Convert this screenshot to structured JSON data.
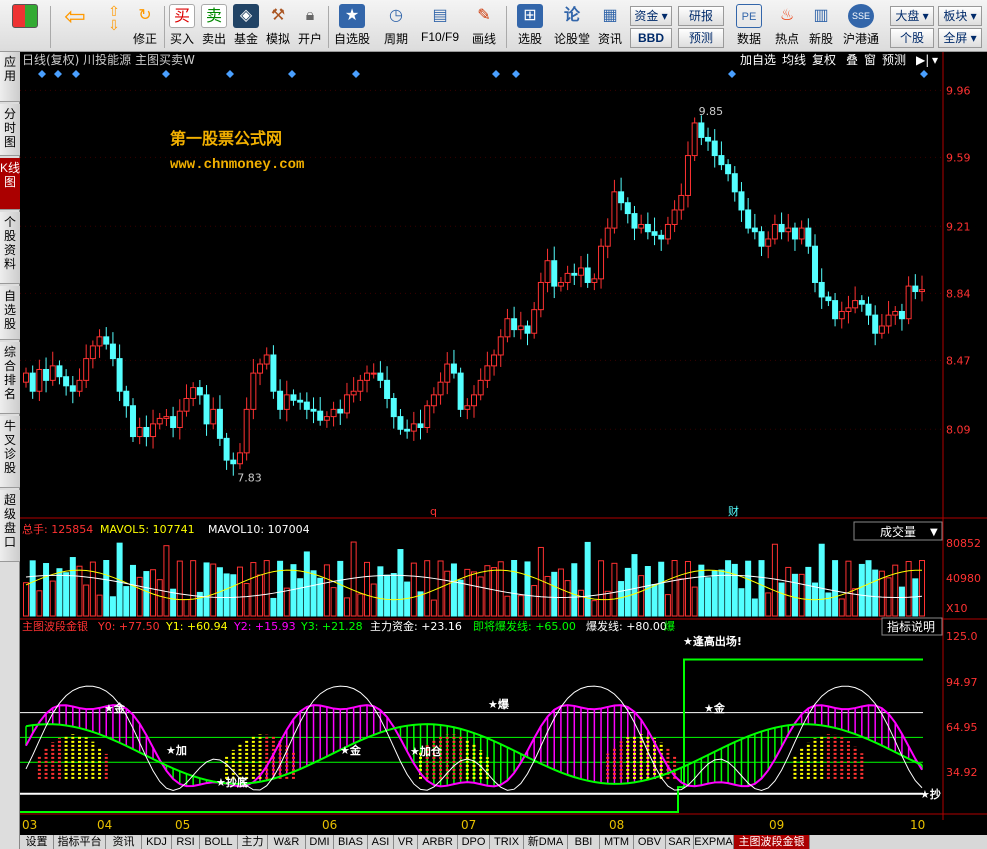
{
  "toolbar": {
    "buttons": [
      {
        "label": "",
        "icon": "app-logo-icon"
      },
      {
        "label": "",
        "icon": "back-arrow-icon"
      },
      {
        "label": "修正",
        "icon": "correct-icon"
      },
      {
        "label": "买入",
        "icon": "buy-icon"
      },
      {
        "label": "卖出",
        "icon": "sell-icon"
      },
      {
        "label": "基金",
        "icon": "fund-icon"
      },
      {
        "label": "模拟",
        "icon": "simulate-icon"
      },
      {
        "label": "开户",
        "icon": "lock-icon"
      },
      {
        "label": "自选股",
        "icon": "star-icon"
      },
      {
        "label": "周期",
        "icon": "clock-icon"
      },
      {
        "label": "F10/F9",
        "icon": "f10-icon"
      },
      {
        "label": "画线",
        "icon": "pen-icon"
      },
      {
        "label": "选股",
        "icon": "filter-icon"
      },
      {
        "label": "论股堂",
        "icon": "forum-icon"
      },
      {
        "label": "资讯",
        "icon": "news-icon"
      },
      {
        "label": "数据",
        "icon": "pe-icon"
      },
      {
        "label": "热点",
        "icon": "hot-icon"
      },
      {
        "label": "新股",
        "icon": "newstock-icon"
      },
      {
        "label": "沪港通",
        "icon": "hk-icon"
      }
    ],
    "buy_glyph": "买",
    "sell_glyph": "卖",
    "small": {
      "zijin": "资金",
      "bbd": "BBD",
      "yanbao": "研报",
      "yuce": "预测",
      "dapan": "大盘",
      "bankuai": "板块",
      "gegu": "个股",
      "quanping": "全屏"
    }
  },
  "sidenav": [
    "应用",
    "分时图",
    "K线图",
    "个股资料",
    "自选股",
    "综合排名",
    "牛叉诊股",
    "超级盘口"
  ],
  "kline": {
    "header": "日线(复权)  川投能源  主图买卖W",
    "buttons": [
      "加自选",
      "均线",
      "复权",
      "叠",
      "窗",
      "预测"
    ],
    "watermark_title": "第一股票公式网",
    "watermark_url": "www.chnmoney.com",
    "y_ticks": [
      "9.96",
      "9.59",
      "9.21",
      "8.84",
      "8.47",
      "8.09"
    ],
    "max_label": "9.85",
    "min_label": "7.83",
    "marker_q": "q",
    "marker_cai": "财"
  },
  "volume": {
    "total": "总手: 125854",
    "mavol5": "MAVOL5: 107741",
    "mavol10": "MAVOL10: 107004",
    "select": "成交量",
    "y_ticks": [
      "80852",
      "40980",
      "X10"
    ]
  },
  "indicator": {
    "name": "主图波段金银",
    "y0": "Y0: +77.50",
    "y1": "Y1: +60.94",
    "y2": "Y2: +15.93",
    "y3": "Y3: +21.28",
    "zhuli": "主力资金: +23.16",
    "jijiang": "即将爆发线: +65.00",
    "baofa": "爆发线: +80.00",
    "bao": "爆",
    "help": "指标说明",
    "y_ticks": [
      "125.0",
      "94.97",
      "64.95",
      "34.92"
    ],
    "annotations": {
      "escape": "★逢高出场!",
      "buy1": "★金",
      "chaodi": "★抄底",
      "jia1": "★加",
      "jia2": "★加仓",
      "jin2": "★金",
      "chao": "★抄",
      "baofa": "★爆",
      "jin3": "★金"
    }
  },
  "dates": [
    "03",
    "04",
    "05",
    "06",
    "07",
    "08",
    "09",
    "10"
  ],
  "tabs": [
    "设置",
    "指标平台",
    "资讯",
    "KDJ",
    "RSI",
    "BOLL",
    "主力",
    "W&R",
    "DMI",
    "BIAS",
    "ASI",
    "VR",
    "ARBR",
    "DPO",
    "TRIX",
    "新DMA",
    "BBI",
    "MTM",
    "OBV",
    "SAR",
    "EXPMA",
    "主图波段金银"
  ],
  "colors": {
    "up": "#ff3232",
    "down": "#54ffff",
    "axis": "#b00000",
    "ma": "#ffffff",
    "yellow": "#ffff00",
    "green": "#00ff00",
    "magenta": "#ff00ff"
  },
  "chart_data": [
    {
      "type": "candlestick",
      "title": "川投能源 日线(复权)",
      "x": [
        "03",
        "04",
        "05",
        "06",
        "07",
        "08",
        "09",
        "10"
      ],
      "ylim": [
        7.7,
        10.05
      ],
      "open": [
        8.35,
        8.4,
        8.3,
        8.42,
        8.36,
        8.44,
        8.38,
        8.33,
        8.3,
        8.36,
        8.48,
        8.55,
        8.6,
        8.56,
        8.48,
        8.3,
        8.22,
        8.05,
        8.1,
        8.05,
        8.12,
        8.15,
        8.16,
        8.1,
        8.19,
        8.26,
        8.32,
        8.28,
        8.12,
        8.2,
        8.04,
        7.92,
        7.9,
        7.96,
        8.2,
        8.4,
        8.45,
        8.5,
        8.3,
        8.2,
        8.28,
        8.25,
        8.24,
        8.2,
        8.19,
        8.14,
        8.16,
        8.2,
        8.18,
        8.28,
        8.3,
        8.36,
        8.4,
        8.4,
        8.36,
        8.26,
        8.16,
        8.09,
        8.08,
        8.12,
        8.1,
        8.22,
        8.28,
        8.35,
        8.45,
        8.4,
        8.2,
        8.22,
        8.28,
        8.36,
        8.44,
        8.5,
        8.6,
        8.7,
        8.64,
        8.66,
        8.62,
        8.75,
        8.9,
        9.02,
        8.88,
        8.9,
        8.95,
        8.94,
        8.98,
        8.9,
        8.92,
        9.1,
        9.2,
        9.4,
        9.34,
        9.28,
        9.2,
        9.22,
        9.18,
        9.16,
        9.14,
        9.22,
        9.3,
        9.38,
        9.6,
        9.78,
        9.7,
        9.68,
        9.6,
        9.55,
        9.5,
        9.4,
        9.3,
        9.2,
        9.18,
        9.1,
        9.14,
        9.22,
        9.18,
        9.2,
        9.14,
        9.2,
        9.1,
        8.9,
        8.82,
        8.8,
        8.7,
        8.74,
        8.76,
        8.8,
        8.78,
        8.72,
        8.62,
        8.66,
        8.72,
        8.74,
        8.7,
        8.88,
        8.85
      ],
      "close": [
        8.4,
        8.3,
        8.42,
        8.36,
        8.44,
        8.38,
        8.33,
        8.3,
        8.36,
        8.48,
        8.55,
        8.6,
        8.56,
        8.48,
        8.3,
        8.22,
        8.05,
        8.1,
        8.05,
        8.12,
        8.15,
        8.16,
        8.1,
        8.19,
        8.26,
        8.32,
        8.28,
        8.12,
        8.2,
        8.04,
        7.92,
        7.9,
        7.96,
        8.2,
        8.4,
        8.45,
        8.5,
        8.3,
        8.2,
        8.28,
        8.25,
        8.24,
        8.2,
        8.19,
        8.14,
        8.16,
        8.2,
        8.18,
        8.28,
        8.3,
        8.36,
        8.4,
        8.4,
        8.36,
        8.26,
        8.16,
        8.09,
        8.08,
        8.12,
        8.1,
        8.22,
        8.28,
        8.35,
        8.45,
        8.4,
        8.2,
        8.22,
        8.28,
        8.36,
        8.44,
        8.5,
        8.6,
        8.7,
        8.64,
        8.66,
        8.62,
        8.75,
        8.9,
        9.02,
        8.88,
        8.9,
        8.95,
        8.94,
        8.98,
        8.9,
        8.92,
        9.1,
        9.2,
        9.4,
        9.34,
        9.28,
        9.2,
        9.22,
        9.18,
        9.16,
        9.14,
        9.22,
        9.3,
        9.38,
        9.6,
        9.78,
        9.7,
        9.68,
        9.6,
        9.55,
        9.5,
        9.4,
        9.3,
        9.2,
        9.18,
        9.1,
        9.14,
        9.22,
        9.18,
        9.2,
        9.14,
        9.2,
        9.1,
        8.9,
        8.82,
        8.8,
        8.7,
        8.74,
        8.76,
        8.8,
        8.78,
        8.72,
        8.62,
        8.66,
        8.72,
        8.74,
        8.7,
        8.88,
        8.85,
        8.86
      ],
      "volume_ylim": [
        0,
        80852
      ]
    }
  ]
}
